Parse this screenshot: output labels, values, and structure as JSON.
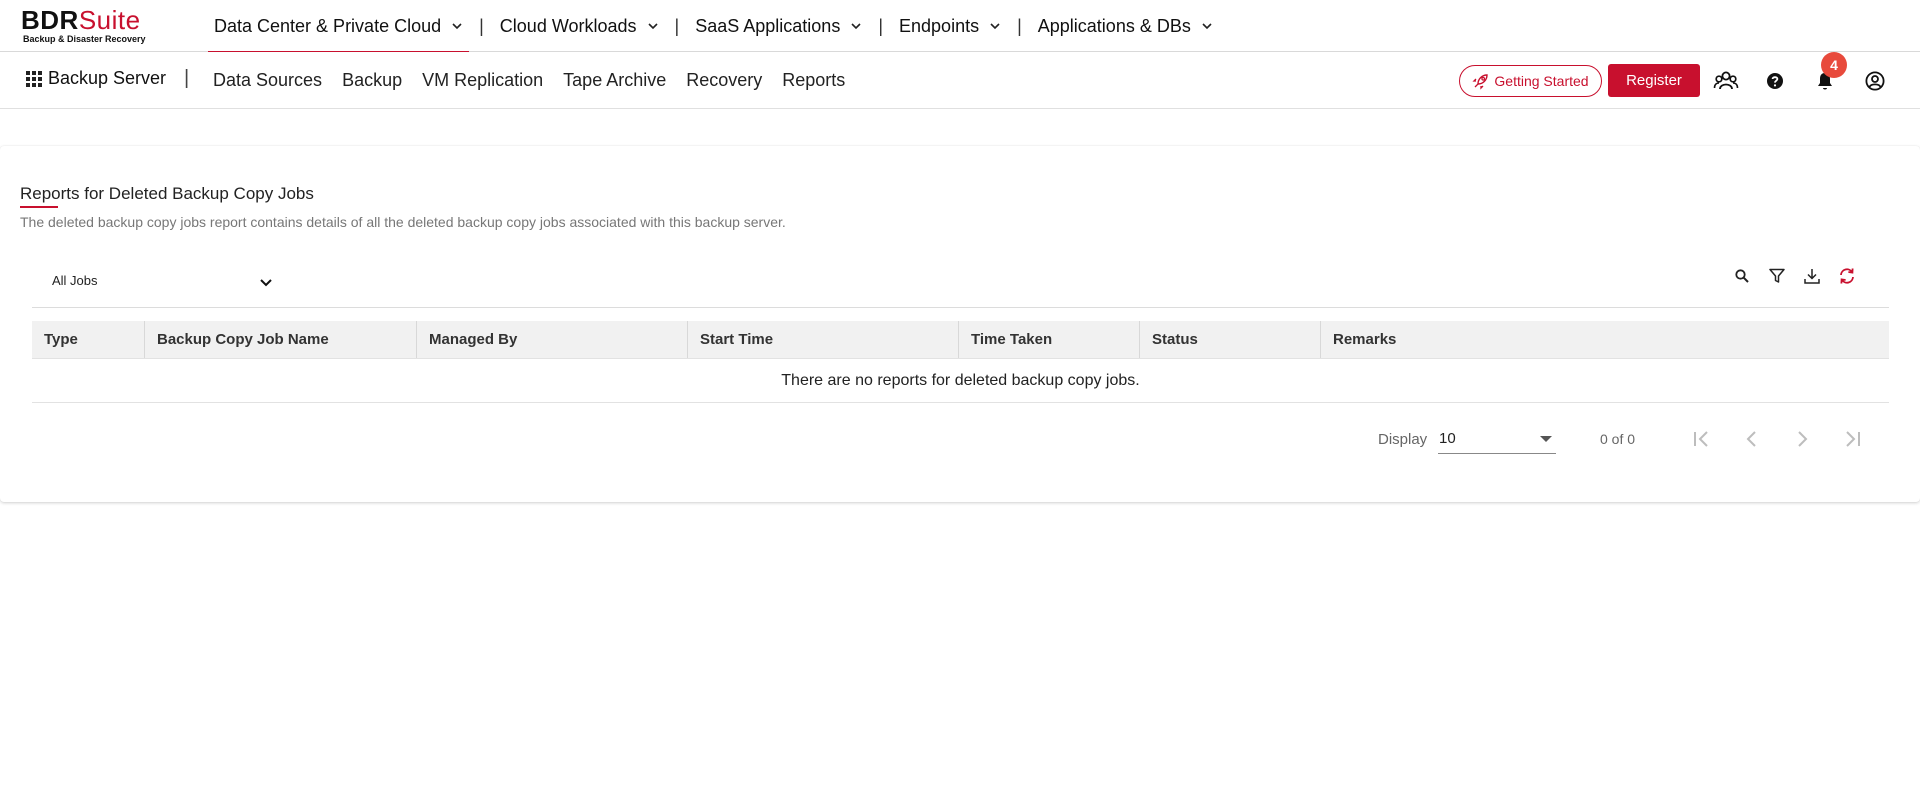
{
  "logo": {
    "brand_prefix": "BDR",
    "brand_suffix": "Suite",
    "tagline": "Backup & Disaster Recovery"
  },
  "product_nav": {
    "items": [
      {
        "label": "Data Center & Private Cloud",
        "active": true
      },
      {
        "label": "Cloud Workloads"
      },
      {
        "label": "SaaS Applications"
      },
      {
        "label": "Endpoints"
      },
      {
        "label": "Applications & DBs"
      }
    ],
    "separator": "|"
  },
  "sub_nav": {
    "app_title": "Backup Server",
    "separator": "|",
    "items": [
      "Data Sources",
      "Backup",
      "VM Replication",
      "Tape Archive",
      "Recovery",
      "Reports"
    ]
  },
  "header_actions": {
    "getting_started_label": "Getting Started",
    "register_label": "Register",
    "notification_count": "4",
    "icons": [
      "community-icon",
      "help-icon",
      "bell-icon",
      "user-account-icon"
    ]
  },
  "page": {
    "title": "Reports for Deleted Backup Copy Jobs",
    "description": "The deleted backup copy jobs report contains details of all the deleted backup copy jobs associated with this backup server."
  },
  "filter": {
    "selected": "All Jobs"
  },
  "table_tools": [
    "search-icon",
    "filter-icon",
    "download-icon",
    "refresh-icon"
  ],
  "table": {
    "columns": [
      "Type",
      "Backup Copy Job Name",
      "Managed By",
      "Start Time",
      "Time Taken",
      "Status",
      "Remarks"
    ],
    "empty_message": "There are no reports for deleted backup copy jobs."
  },
  "pagination": {
    "display_label": "Display",
    "page_size": "10",
    "count": "0 of 0"
  },
  "colors": {
    "accent": "#c8102e",
    "badge": "#e84a3c"
  }
}
